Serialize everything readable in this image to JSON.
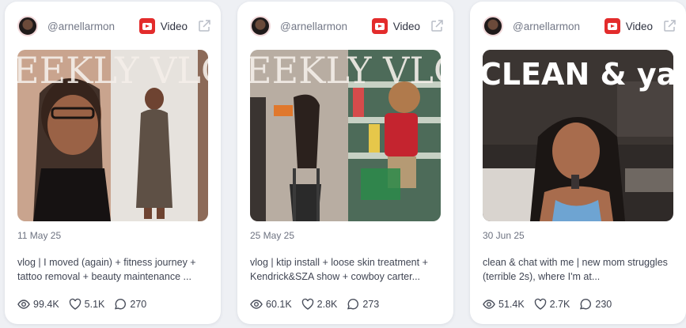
{
  "cards": [
    {
      "handle": "@arnellarmon",
      "platform_label": "Video",
      "overlay_text": "EEKLY VLO",
      "date": "11 May 25",
      "title": "vlog | I moved (again) + fitness journey + tattoo removal + beauty maintenance ...",
      "views": "99.4K",
      "likes": "5.1K",
      "comments": "270"
    },
    {
      "handle": "@arnellarmon",
      "platform_label": "Video",
      "overlay_text": "EEKLY VLO",
      "date": "25 May 25",
      "title": "vlog | ktip install + loose skin treatment + Kendrick&SZA show + cowboy carter...",
      "views": "60.1K",
      "likes": "2.8K",
      "comments": "273"
    },
    {
      "handle": "@arnellarmon",
      "platform_label": "Video",
      "overlay_text": "CLEAN & yap",
      "date": "30 Jun 25",
      "title": "clean & chat with me | new mom struggles (terrible 2s), where I'm at...",
      "views": "51.4K",
      "likes": "2.7K",
      "comments": "230"
    }
  ],
  "icons": {
    "platform": "youtube-icon",
    "external": "external-link-icon",
    "views": "eye-icon",
    "likes": "heart-icon",
    "comments": "comment-icon"
  },
  "colors": {
    "youtube_red": "#e32c2c",
    "background": "#eef0f4",
    "card": "#ffffff"
  }
}
